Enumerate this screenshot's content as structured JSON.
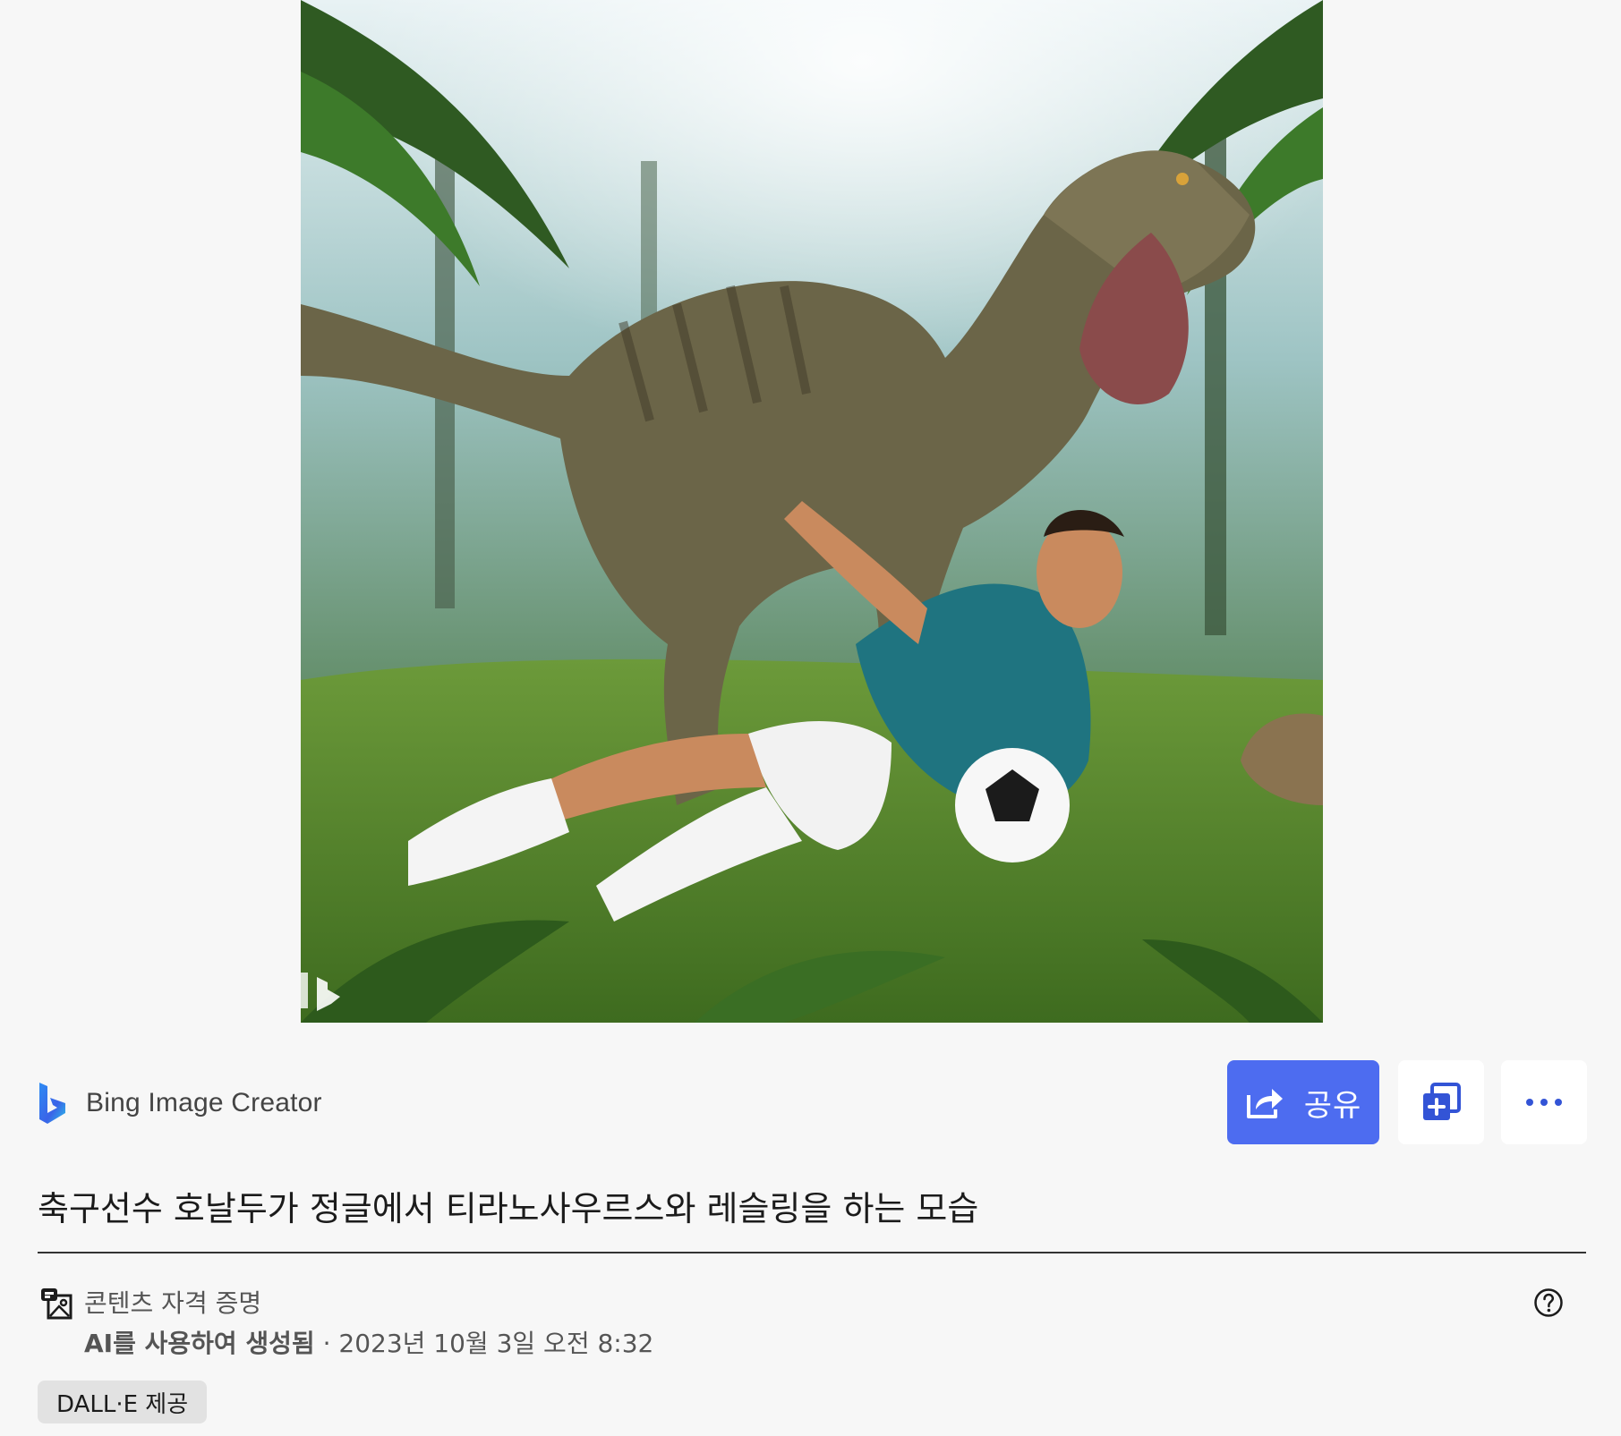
{
  "image": {
    "alt": "축구선수 호날두가 정글에서 티라노사우르스와 레슬링을 하는 모습",
    "watermark_icon": "bing-b-icon"
  },
  "creator": {
    "name": "Bing Image Creator",
    "logo_icon": "bing-logo-icon"
  },
  "actions": {
    "share_label": "공유",
    "share_icon": "share-arrow-icon",
    "collection_icon": "add-to-collection-icon",
    "more_icon": "more-horizontal-icon",
    "accent_color": "#4d6cf0"
  },
  "prompt": {
    "text": "축구선수 호날두가 정글에서 티라노사우르스와 레슬링을 하는 모습"
  },
  "credentials": {
    "title": "콘텐츠 자격 증명",
    "generated_label": "AI를 사용하여 생성됨",
    "separator": " · ",
    "date": "2023년 10월 3일 오전 8:32",
    "provider": "DALL·E 제공",
    "icon": "content-credentials-icon",
    "help_icon": "help-circle-icon"
  }
}
